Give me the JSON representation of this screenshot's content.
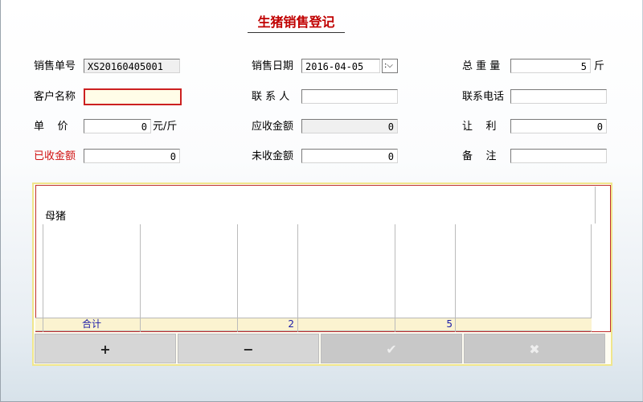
{
  "title": "生猪销售登记",
  "form": {
    "order_no_label": "销售单号",
    "order_no_value": "XS20160405001",
    "sale_date_label": "销售日期",
    "sale_date_value": "2016-04-05",
    "total_weight_label": "总 重 量",
    "total_weight_value": "5",
    "total_weight_unit": "斤",
    "customer_label": "客户名称",
    "customer_value": "",
    "contact_label": "联 系 人",
    "contact_value": "",
    "phone_label": "联系电话",
    "phone_value": "",
    "unit_price_label": "单    价",
    "unit_price_value": "0",
    "unit_price_unit": "元/斤",
    "receivable_label": "应收金额",
    "receivable_value": "0",
    "discount_label": "让    利",
    "discount_value": "0",
    "received_label": "已收金额",
    "received_value": "0",
    "unreceived_label": "未收金额",
    "unreceived_value": "0",
    "remark_label": "备    注",
    "remark_value": ""
  },
  "grid": {
    "group_label": "母猪",
    "summary": {
      "label": "合计",
      "col3_value": "2",
      "col5_value": "5"
    }
  },
  "buttons": {
    "add": "+",
    "remove": "−",
    "confirm": "✔",
    "cancel": "✖"
  }
}
